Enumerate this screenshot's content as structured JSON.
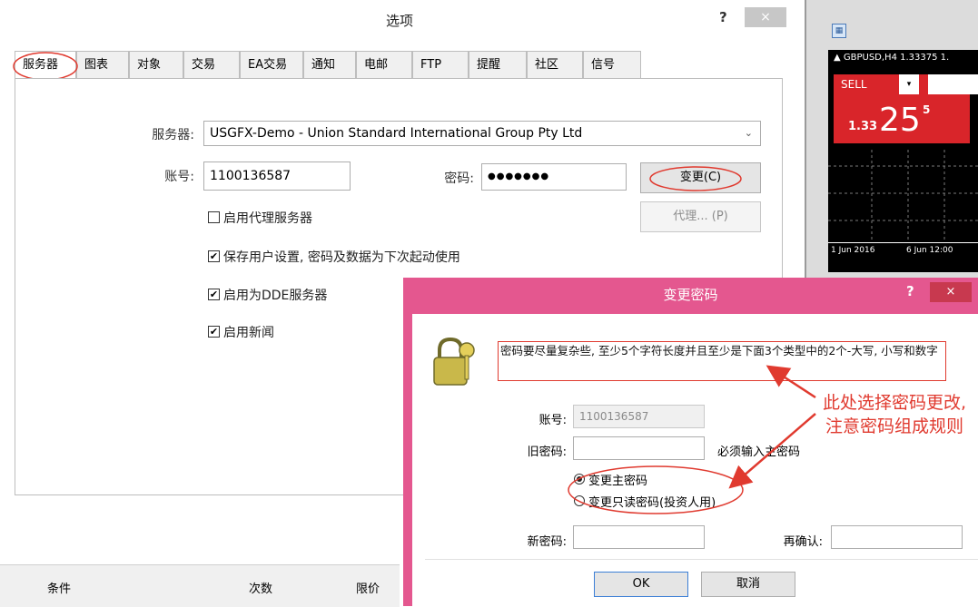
{
  "options_window": {
    "title": "选项",
    "help": "?",
    "close": "×",
    "tabs": [
      "服务器",
      "图表",
      "对象",
      "交易",
      "EA交易",
      "通知",
      "电邮",
      "FTP",
      "提醒",
      "社区",
      "信号"
    ],
    "server_label": "服务器:",
    "server_value": "USGFX-Demo - Union Standard International Group Pty Ltd",
    "account_label": "账号:",
    "account_value": "1100136587",
    "password_label": "密码:",
    "password_value": "●●●●●●●",
    "change_button": "变更(C)",
    "proxy_button": "代理... (P)",
    "checkbox_proxy": "启用代理服务器",
    "checkbox_save": "保存用户设置, 密码及数据为下次起动使用",
    "checkbox_dde": "启用为DDE服务器",
    "checkbox_news": "启用新闻",
    "checked": "✔"
  },
  "bottom_table": {
    "headers": [
      "条件",
      "次数",
      "限价"
    ]
  },
  "chart": {
    "symbol": "▲ GBPUSD,H4  1.33375 1.",
    "sell_label": "SELL",
    "price_main": "1.33",
    "price_big": "25",
    "price_sup": "5",
    "dates": [
      "1 Jun 2016",
      "6 Jun 12:00"
    ]
  },
  "change_password_dialog": {
    "title": "变更密码",
    "help": "?",
    "close": "×",
    "hint": "密码要尽量复杂些, 至少5个字符长度并且至少是下面3个类型中的2个-大写, 小写和数字",
    "account_label": "账号:",
    "account_value": "1100136587",
    "old_password_label": "旧密码:",
    "required_note": "必须输入主密码",
    "radio_master": "变更主密码",
    "radio_readonly": "变更只读密码(投资人用)",
    "new_password_label": "新密码:",
    "confirm_label": "再确认:",
    "ok": "OK",
    "cancel": "取消"
  },
  "annotation": {
    "line1": "此处选择密码更改,",
    "line2": "注意密码组成规则"
  },
  "colors": {
    "annotation_red": "#e03a2f",
    "dialog_border": "#e4578f",
    "sell_red": "#d9252a"
  }
}
